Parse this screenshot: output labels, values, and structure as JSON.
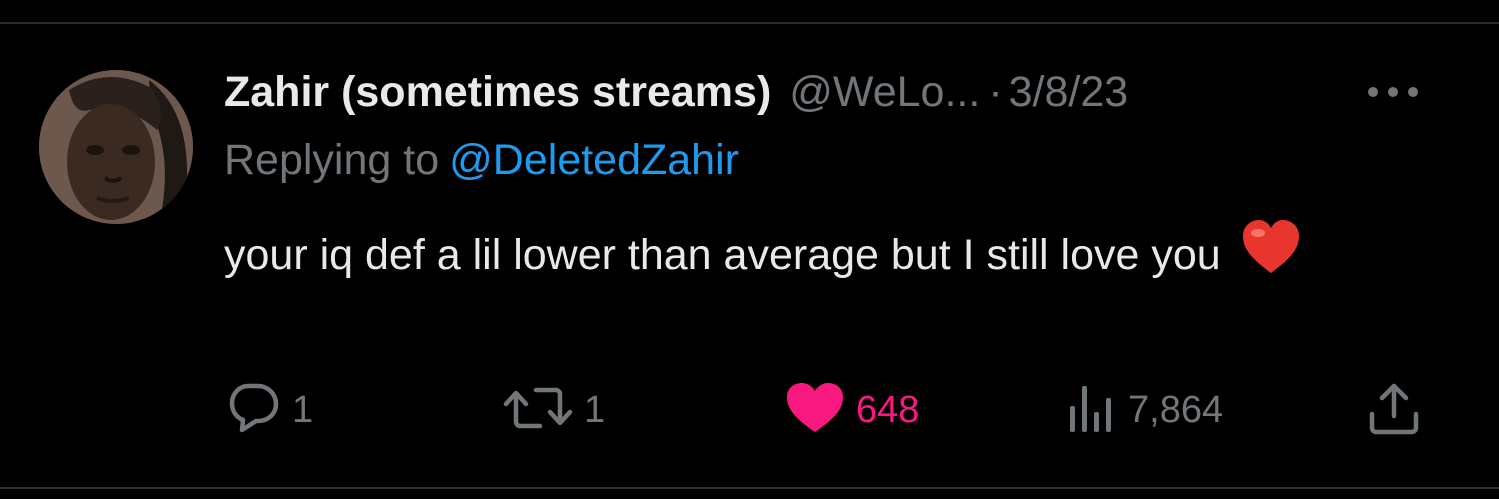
{
  "tweet": {
    "display_name": "Zahir (sometimes streams)",
    "handle": "@WeLo...",
    "separator": "·",
    "date": "3/8/23",
    "reply_prefix": "Replying to",
    "reply_to": "@DeletedZahir",
    "text": "your iq def a lil lower than average but I still love you",
    "emoji": "❤️"
  },
  "actions": {
    "reply_count": "1",
    "retweet_count": "1",
    "like_count": "648",
    "views_count": "7,864"
  },
  "colors": {
    "background": "#000000",
    "text": "#e7e9ea",
    "secondary": "#71767b",
    "link": "#1d9bf0",
    "like": "#f91880"
  },
  "icons": {
    "avatar": "avatar",
    "more": "more-dots-icon",
    "reply": "reply-icon",
    "retweet": "retweet-icon",
    "like": "heart-icon",
    "views": "views-icon",
    "share": "share-icon"
  }
}
